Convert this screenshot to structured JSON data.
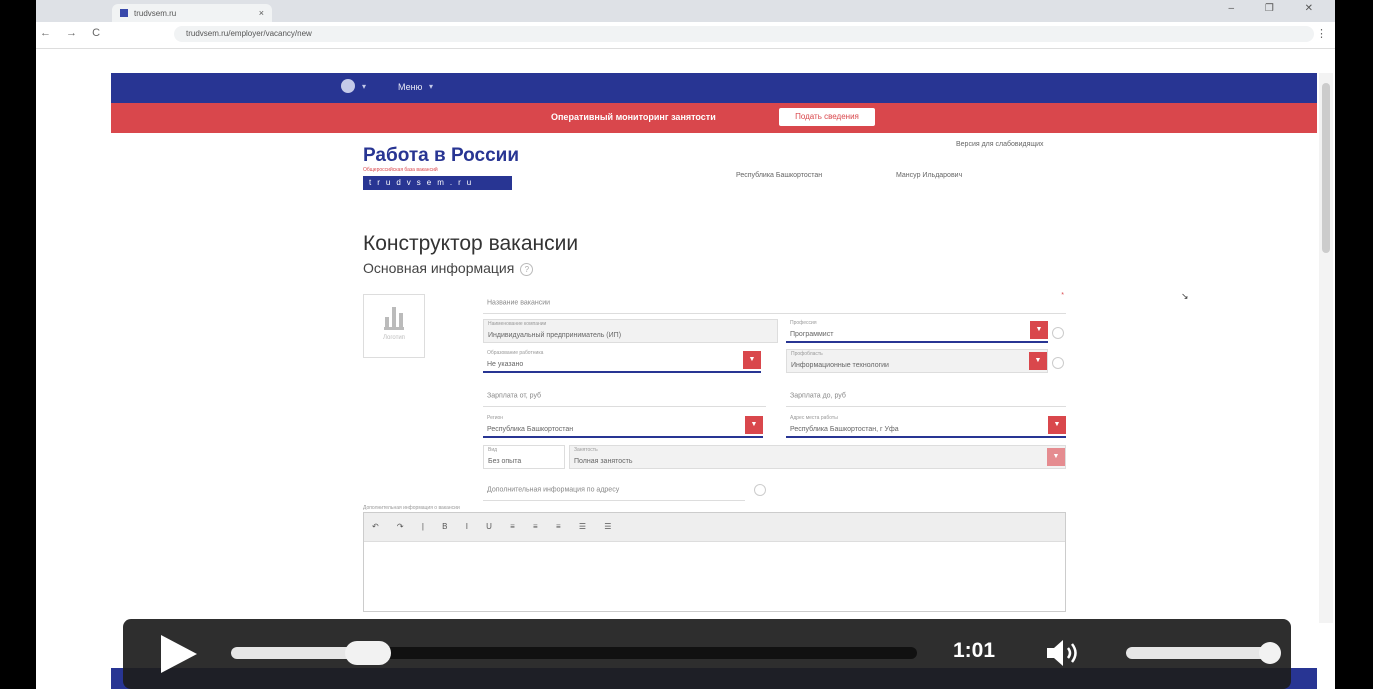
{
  "browser": {
    "tab_title": "trudvsem.ru",
    "address": "trudvsem.ru/employer/vacancy/new",
    "nav_glyphs": "← → C",
    "window_controls": "– ❐ ✕",
    "menu_glyph": "⋮",
    "tab_close": "×"
  },
  "site": {
    "menu_label": "Меню",
    "alert_text": "Оперативный мониторинг занятости",
    "alert_button": "Подать сведения",
    "logo_title": "Работа в России",
    "logo_subtitle": "Общероссийская база вакансий",
    "logo_tagline": "trudvsem.ru",
    "version_link": "Версия для слабовидящих",
    "region": "Республика Башкортостан",
    "user": "Мансур Ильдарович"
  },
  "page": {
    "title": "Конструктор вакансии",
    "section": "Основная информация",
    "logo_upload_label": "Логотип"
  },
  "form": {
    "vacancy_name_placeholder": "Название вакансии",
    "org_label": "Наименование компании",
    "org_value": "Индивидуальный предприниматель (ИП)",
    "profession_label": "Профессия",
    "profession_value": "Программист",
    "education_label": "Образование работника",
    "education_value": "Не указано",
    "category_label": "Профобласть",
    "category_value": "Информационные технологии",
    "salary_from_placeholder": "Зарплата от, руб",
    "salary_to_placeholder": "Зарплата до, руб",
    "region_label": "Регион",
    "region_value": "Республика Башкортостан",
    "address_label": "Адрес места работы",
    "address_value": "Республика Башкортостан, г Уфа",
    "schedule_label": "Вид",
    "schedule_value": "Без опыта",
    "employment_label": "Занятость",
    "employment_value": "Полная занятость",
    "extra_address_placeholder": "Дополнительная информация по адресу",
    "editor_label": "Дополнительная информация о вакансии",
    "editor_tools": "↶ ↷ | B I U ≡ ≡ ≡ ☰ ☰"
  },
  "player": {
    "time": "1:01",
    "progress": 0.2,
    "volume": 0.95
  }
}
